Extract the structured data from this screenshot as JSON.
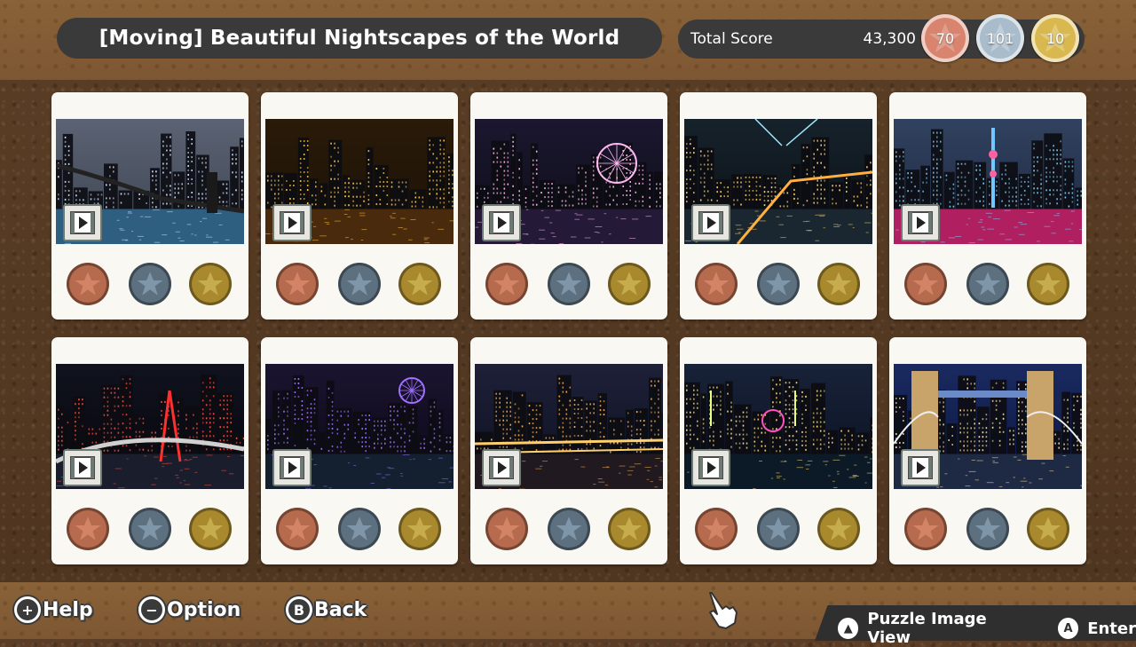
{
  "header": {
    "title": "[Moving] Beautiful Nightscapes of the World",
    "score_label": "Total Score",
    "score_value": "43,300",
    "medals": {
      "bronze": "70",
      "silver": "101",
      "gold": "10"
    }
  },
  "colors": {
    "bronze": "#b66a4e",
    "silver": "#5d7080",
    "gold": "#a8892e",
    "panel": "#3a3a3a",
    "cork": "#5a3d24"
  },
  "puzzles": [
    {
      "scene": "bridge-skyline-dusk",
      "icon": "film-play-icon"
    },
    {
      "scene": "golden-city-towers",
      "icon": "film-play-icon"
    },
    {
      "scene": "ferris-wheel-harbor",
      "icon": "film-play-icon"
    },
    {
      "scene": "marina-light-beams",
      "icon": "film-play-icon"
    },
    {
      "scene": "tv-tower-riverfront",
      "icon": "film-play-icon"
    },
    {
      "scene": "red-bridge-interchange",
      "icon": "film-play-icon"
    },
    {
      "scene": "waterfront-ferris-wheel",
      "icon": "film-play-icon"
    },
    {
      "scene": "river-bridges-panorama",
      "icon": "film-play-icon"
    },
    {
      "scene": "harbor-bridges-fireworks",
      "icon": "film-play-icon"
    },
    {
      "scene": "tower-bridge",
      "icon": "film-play-icon"
    }
  ],
  "footer": {
    "help": {
      "symbol": "+",
      "label": "Help"
    },
    "option": {
      "symbol": "−",
      "label": "Option"
    },
    "back": {
      "symbol": "B",
      "label": "Back"
    },
    "view": {
      "symbol": "▲",
      "label": "Puzzle Image View"
    },
    "enter": {
      "symbol": "A",
      "label": "Enter"
    }
  }
}
